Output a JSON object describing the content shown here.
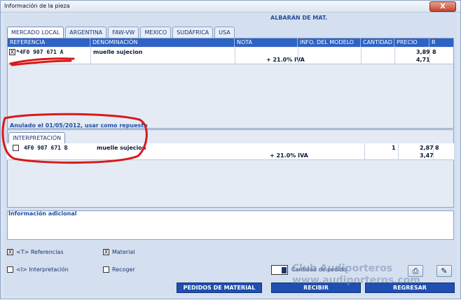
{
  "window": {
    "title": "Información de la pieza",
    "close_label": "X"
  },
  "header": {
    "label": "ALBARÁN DE MAT."
  },
  "tabs": [
    "MERCADO LOCAL",
    "ARGENTINA",
    "FAW-VW",
    "MEXICO",
    "SUDÁFRICA",
    "USA"
  ],
  "grid": {
    "columns": [
      "REFERENCIA",
      "DENOMINACIÓN",
      "NOTA",
      "INFO. DEL MODELO",
      "CANTIDAD",
      "PRECIO",
      "R"
    ],
    "row": {
      "referencia": "*4F0 907 671 A",
      "denominacion": "muelle sujecion",
      "iva": "+ 21.0% IVA",
      "precio": "3,89",
      "precio_iva": "4,71",
      "r": "8",
      "checked_mark": "X"
    }
  },
  "anulado": "Anulado el 01/05/2012, usar como repuesto",
  "interp": {
    "tab": "INTERPRETACIÓN",
    "row": {
      "referencia": "4F0 907 671 B",
      "denominacion": "muelle sujecion",
      "iva": "+ 21.0% IVA",
      "cantidad": "1",
      "precio": "2,87",
      "precio_iva": "3,47",
      "r": "8"
    }
  },
  "info": {
    "label": "Información adicional"
  },
  "options": {
    "referencias": "<T> Referencias",
    "material": "Material",
    "interpretacion": "<I> Interpretación",
    "recoger": "Recoger",
    "check_mark": "X"
  },
  "qty": {
    "label": "Cantidad de pedido"
  },
  "buttons": {
    "pedidos": "PEDIDOS DE MATERIAL",
    "recibir": "RECIBIR",
    "regresar": "REGRESAR"
  },
  "watermark": {
    "line1": "Club Audiporteros",
    "line2": "www.audiporteros.com"
  },
  "colors": {
    "header_blue": "#2e62c4",
    "button_blue": "#1f4fb2",
    "annotation_red": "#d81a1a"
  }
}
